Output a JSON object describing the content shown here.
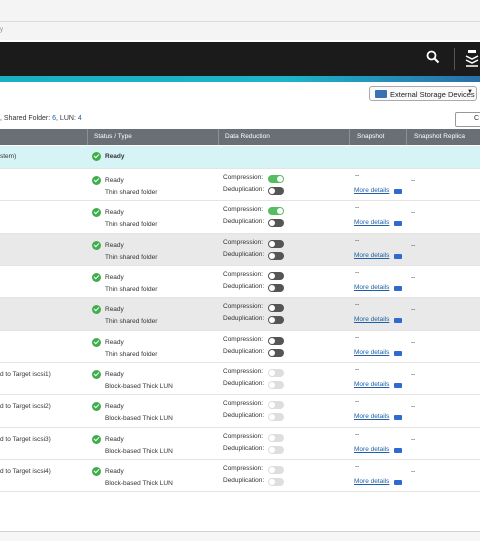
{
  "top": {
    "fragment": "y"
  },
  "toolbar": {
    "external_storage_label": "External Storage Devices",
    "close_label": "C"
  },
  "summary": {
    "prefix": ", Shared Folder: ",
    "shared_count": "6",
    "lun_prefix": ", LUN: ",
    "lun_count": "4"
  },
  "columns": [
    "Status / Type",
    "Data Reduction",
    "Snapshot",
    "Snapshot Replica"
  ],
  "labels": {
    "compression": "Compression:",
    "deduplication": "Deduplication:",
    "more_details": "More details",
    "dash": "--"
  },
  "rows": [
    {
      "name": "stem)",
      "status": "Ready",
      "type": ""
    },
    {
      "name": "",
      "status": "Ready",
      "type": "Thin shared folder",
      "compression": "on",
      "dedup": "off"
    },
    {
      "name": "",
      "status": "Ready",
      "type": "Thin shared folder",
      "compression": "on",
      "dedup": "off"
    },
    {
      "name": "",
      "status": "Ready",
      "type": "Thin shared folder",
      "compression": "off",
      "dedup": "off"
    },
    {
      "name": "",
      "status": "Ready",
      "type": "Thin shared folder",
      "compression": "off",
      "dedup": "off"
    },
    {
      "name": "",
      "status": "Ready",
      "type": "Thin shared folder",
      "compression": "off",
      "dedup": "off"
    },
    {
      "name": "",
      "status": "Ready",
      "type": "Thin shared folder",
      "compression": "off",
      "dedup": "off"
    },
    {
      "name": "d to Target iscsi1)",
      "status": "Ready",
      "type": "Block-based Thick LUN",
      "compression": "disabled",
      "dedup": "disabled"
    },
    {
      "name": "d to Target iscsi2)",
      "status": "Ready",
      "type": "Block-based Thick LUN",
      "compression": "disabled",
      "dedup": "disabled"
    },
    {
      "name": "d to Target iscsi3)",
      "status": "Ready",
      "type": "Block-based Thick LUN",
      "compression": "disabled",
      "dedup": "disabled"
    },
    {
      "name": "d to Target iscsi4)",
      "status": "Ready",
      "type": "Block-based Thick LUN",
      "compression": "disabled",
      "dedup": "disabled"
    }
  ]
}
